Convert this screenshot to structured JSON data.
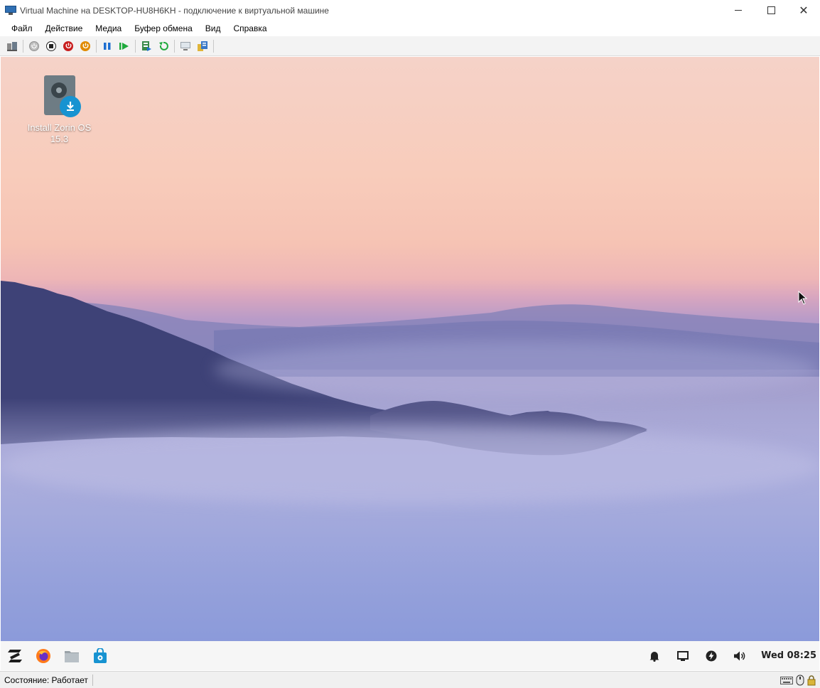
{
  "window": {
    "title": "Virtual Machine на DESKTOP-HU8H6KH - подключение к виртуальной машине",
    "controls": {
      "minimize": "minimize",
      "maximize": "maximize",
      "close": "close"
    }
  },
  "menu": {
    "items": [
      "Файл",
      "Действие",
      "Медиа",
      "Буфер обмена",
      "Вид",
      "Справка"
    ]
  },
  "toolbar": {
    "icons": [
      "ctrl-alt-del-icon",
      "start-icon",
      "turn-off-icon",
      "shutdown-icon",
      "save-state-icon",
      "pause-icon",
      "resume-icon",
      "checkpoint-icon",
      "revert-icon",
      "enhanced-session-icon",
      "share-icon"
    ],
    "colors": {
      "shutdown": "#c81e1e",
      "save": "#e08a00",
      "pause": "#1e6fd2",
      "resume": "#1faa3c"
    }
  },
  "desktop": {
    "icon_label_line1": "Install Zorin OS",
    "icon_label_line2": "15.3",
    "icon_name": "installer-drive-icon"
  },
  "taskbar": {
    "apps": [
      "zorin-menu-icon",
      "firefox-icon",
      "files-icon",
      "software-store-icon"
    ],
    "tray": [
      "notifications-icon",
      "display-icon",
      "power-icon",
      "volume-icon"
    ],
    "clock": "Wed 08:25"
  },
  "status": {
    "text": "Состояние: Работает",
    "icons": [
      "keyboard-icon",
      "mouse-icon",
      "lock-icon"
    ]
  }
}
